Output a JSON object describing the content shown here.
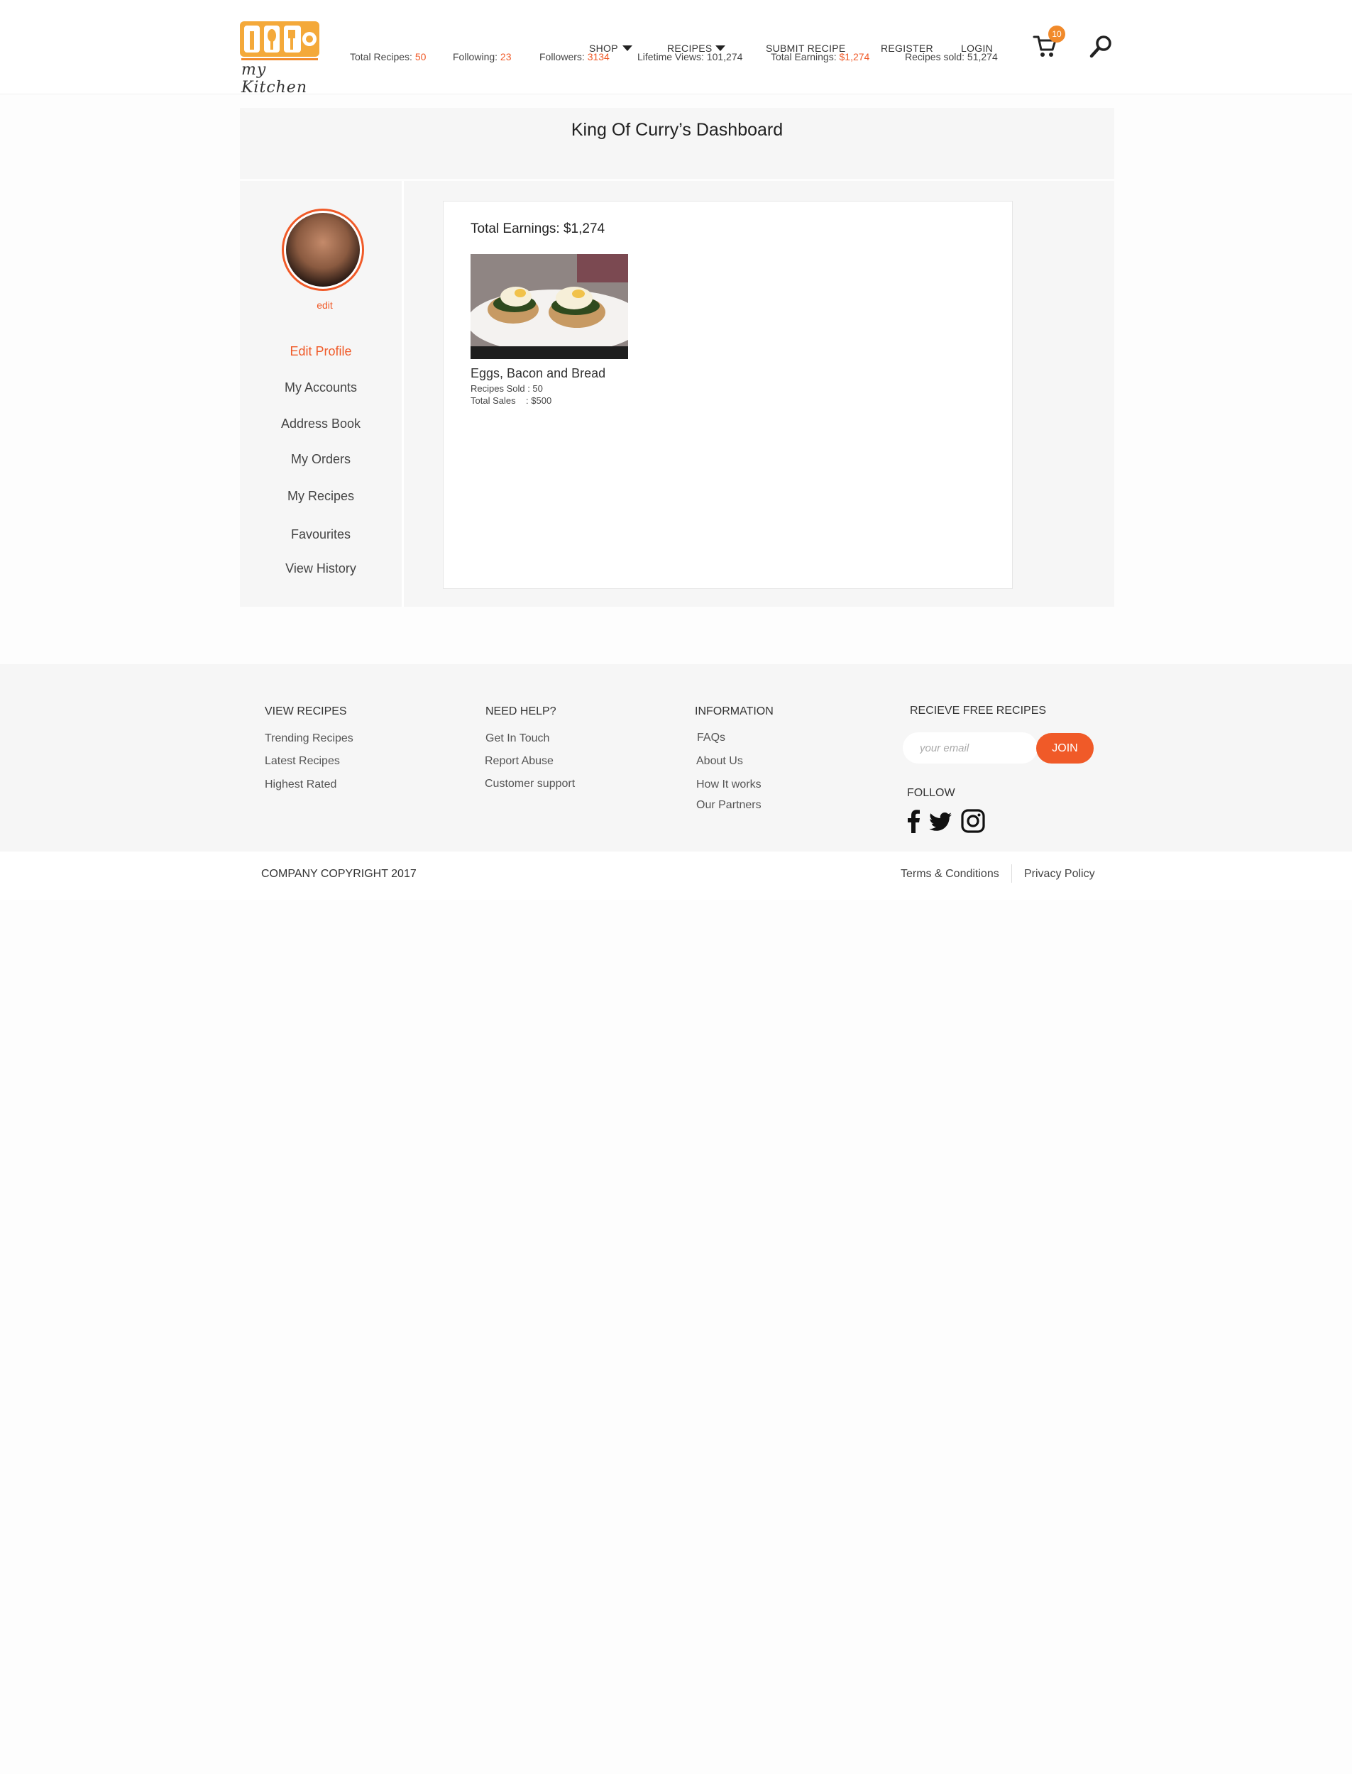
{
  "brand": {
    "logo_text": "my Kitchen"
  },
  "nav": {
    "shop": "SHOP",
    "recipes": "RECIPES",
    "submit": "SUBMIT RECIPE",
    "register": "REGISTER",
    "login": "LOGIN",
    "cart_count": "10"
  },
  "dashboard": {
    "title": "King Of Curry’s Dashboard",
    "stats": {
      "total_recipes_label": "Total Recipes:",
      "total_recipes_value": "50",
      "following_label": "Following:",
      "following_value": "23",
      "followers_label": "Followers:",
      "followers_value": "3134",
      "lifetime_views": "Lifetime Views: 101,274",
      "total_earnings_label": "Total Earnings:",
      "total_earnings_value": "$1,274",
      "recipes_sold": "Recipes sold: 51,274"
    }
  },
  "sidebar": {
    "edit_link": "edit",
    "items": [
      "Edit Profile",
      "My Accounts",
      "Address Book",
      "My Orders",
      "My Recipes",
      "Favourites",
      "View History"
    ]
  },
  "main": {
    "earnings_title": "Total Earnings: $1,274",
    "recipe": {
      "name": "Eggs, Bacon and Bread",
      "sold": "Recipes Sold : 50",
      "sales": "Total Sales    : $500"
    }
  },
  "footer": {
    "col1": {
      "head": "VIEW RECIPES",
      "links": [
        "Trending Recipes",
        "Latest Recipes",
        "Highest Rated"
      ]
    },
    "col2": {
      "head": "NEED HELP?",
      "links": [
        "Get In Touch",
        "Report Abuse",
        "Customer support"
      ]
    },
    "col3": {
      "head": "INFORMATION",
      "links": [
        "FAQs",
        "About Us",
        "How It works",
        "Our Partners"
      ]
    },
    "newsletter": {
      "head": "RECIEVE FREE RECIPES",
      "placeholder": "your email",
      "button": "JOIN"
    },
    "follow": "FOLLOW",
    "copyright": "COMPANY COPYRIGHT 2017",
    "terms": "Terms & Conditions",
    "privacy": "Privacy Policy"
  },
  "colors": {
    "accent": "#f05a28",
    "brand_orange": "#f18a2b",
    "panel": "#f6f6f6"
  }
}
